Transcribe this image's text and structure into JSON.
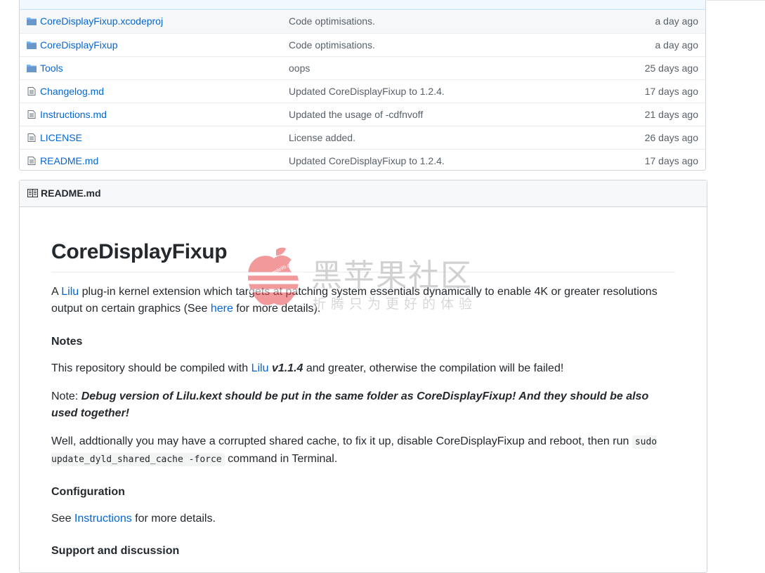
{
  "files": [
    {
      "name": "CoreDisplayFixup.xcodeproj",
      "type": "folder",
      "message": "Code optimisations.",
      "age": "a day ago"
    },
    {
      "name": "CoreDisplayFixup",
      "type": "folder",
      "message": "Code optimisations.",
      "age": "a day ago"
    },
    {
      "name": "Tools",
      "type": "folder",
      "message": "oops",
      "age": "25 days ago"
    },
    {
      "name": "Changelog.md",
      "type": "file",
      "message": "Updated CoreDisplayFixup to 1.2.4.",
      "age": "17 days ago"
    },
    {
      "name": "Instructions.md",
      "type": "file",
      "message": "Updated the usage of -cdfnvoff",
      "age": "21 days ago"
    },
    {
      "name": "LICENSE",
      "type": "file",
      "message": "License added.",
      "age": "26 days ago"
    },
    {
      "name": "README.md",
      "type": "file",
      "message": "Updated CoreDisplayFixup to 1.2.4.",
      "age": "17 days ago"
    }
  ],
  "readme": {
    "header": "README.md",
    "title": "CoreDisplayFixup",
    "intro": {
      "a": "A ",
      "lilu_link": "Lilu",
      "b": " plug-in kernel extension which targets at patching system essentials dynamically to enable 4K or greater resolutions output on certain graphics (See ",
      "here_link": "here",
      "c": " for more details)."
    },
    "notes_heading": "Notes",
    "notes_p1": {
      "a": "This repository should be compiled with ",
      "lilu_link": "Lilu",
      "version": "v1.1.4",
      "b": " and greater, otherwise the compilation will be failed!"
    },
    "notes_p2": {
      "a": "Note: ",
      "emph": "Debug version of Lilu.kext should be put in the same folder as CoreDisplayFixup! And they should be also used together!"
    },
    "notes_p3": {
      "a": "Well, addtionally you may have a corrupted shared cache, to fix it up, disable CoreDisplayFixup and reboot, then run ",
      "code": "sudo update_dyld_shared_cache -force",
      "b": " command in Terminal."
    },
    "config_heading": "Configuration",
    "config_p": {
      "a": "See ",
      "link": "Instructions",
      "b": " for more details."
    },
    "support_heading": "Support and discussion"
  },
  "watermark": {
    "title": "黑苹果社区",
    "subtitle": "折腾只为更好的体验",
    "small": "apple99.cn"
  },
  "colors": {
    "link": "#0366d6",
    "folder_icon": "#79b8ff",
    "muted": "#586069",
    "watermark_red": "#e8474c"
  }
}
